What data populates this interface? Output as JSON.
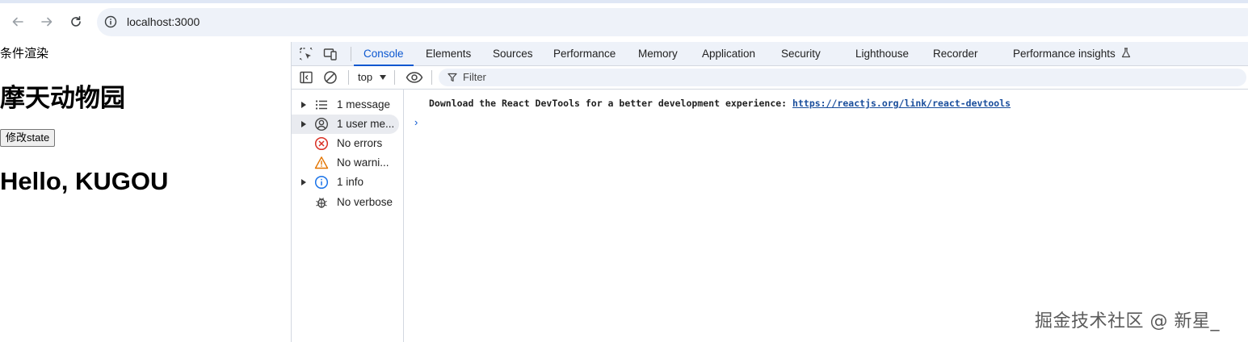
{
  "browser": {
    "url": "localhost:3000"
  },
  "page": {
    "caption": "条件渲染",
    "title": "摩天动物园",
    "button_label": "修改state",
    "greeting": "Hello, KUGOU"
  },
  "devtools": {
    "tabs": [
      "Console",
      "Elements",
      "Sources",
      "Performance",
      "Memory",
      "Application",
      "Security",
      "Lighthouse",
      "Recorder",
      "Performance insights"
    ],
    "active_tab": "Console",
    "context": "top",
    "filter_placeholder": "Filter",
    "sidebar": [
      {
        "label": "1 message",
        "icon": "list-icon",
        "expandable": true
      },
      {
        "label": "1 user me...",
        "icon": "user-icon",
        "expandable": true,
        "selected": true
      },
      {
        "label": "No errors",
        "icon": "error-icon",
        "expandable": false
      },
      {
        "label": "No warni...",
        "icon": "warning-icon",
        "expandable": false
      },
      {
        "label": "1 info",
        "icon": "info-icon",
        "expandable": true
      },
      {
        "label": "No verbose",
        "icon": "bug-icon",
        "expandable": false
      }
    ],
    "console_message": {
      "text": "Download the React DevTools for a better development experience: ",
      "link": "https://reactjs.org/link/react-devtools"
    },
    "prompt_symbol": "›"
  },
  "watermark": "掘金技术社区 @ 新星_",
  "colors": {
    "accent": "#0b57d0",
    "link": "#1a4e9c",
    "error": "#d93025",
    "warning": "#e37400",
    "info": "#1a73e8"
  }
}
